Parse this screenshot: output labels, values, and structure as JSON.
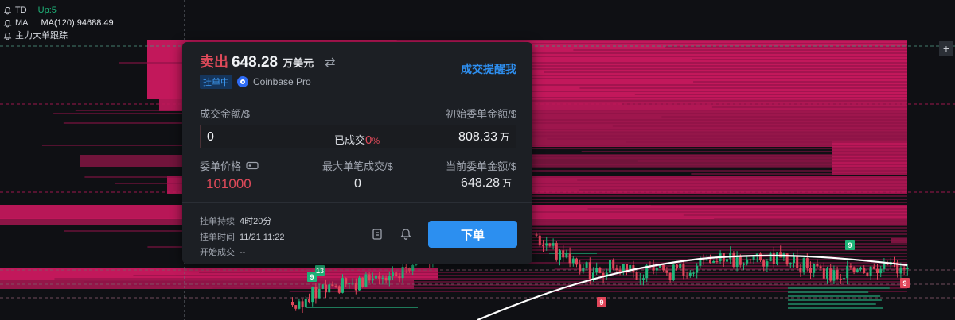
{
  "legend": {
    "td_label": "TD",
    "td_value": "Up:5",
    "ma_label": "MA",
    "ma_value": "MA(120):94688.49",
    "tracker_label": "主力大单跟踪"
  },
  "panel": {
    "side": "卖出",
    "amount": "648.28",
    "unit": "万美元",
    "remind_label": "成交提醒我",
    "status_badge": "挂单中",
    "exchange": "Coinbase Pro",
    "filled_amount_label": "成交金额/$",
    "initial_amount_label": "初始委单金额/$",
    "filled_amount_value": "0",
    "filled_pct_label": "已成交",
    "filled_pct_value": "0",
    "filled_pct_sign": "%",
    "initial_amount_value": "808.33",
    "wan": "万",
    "order_price_label": "委单价格",
    "max_single_label": "最大单笔成交/$",
    "current_amount_label": "当前委单金额/$",
    "order_price_value": "101000",
    "max_single_value": "0",
    "current_amount_value": "648.28",
    "duration_label": "挂单持续",
    "duration_value": "4时20分",
    "order_time_label": "挂单时间",
    "order_time_value": "11/21 11:22",
    "start_fill_label": "开始成交",
    "start_fill_value": "--",
    "order_button": "下单"
  },
  "markers": [
    "9",
    "13",
    "9",
    "9",
    "9"
  ],
  "colors": {
    "background": "#0f1014",
    "sell_wall": "#c2185b",
    "buy_wall": "#1e7a5a",
    "up_candle": "#1fb57a",
    "down_candle": "#e0465a",
    "ma_line": "#ffffff",
    "accent_blue": "#2c8ff0",
    "sell_red": "#e04a5a"
  }
}
